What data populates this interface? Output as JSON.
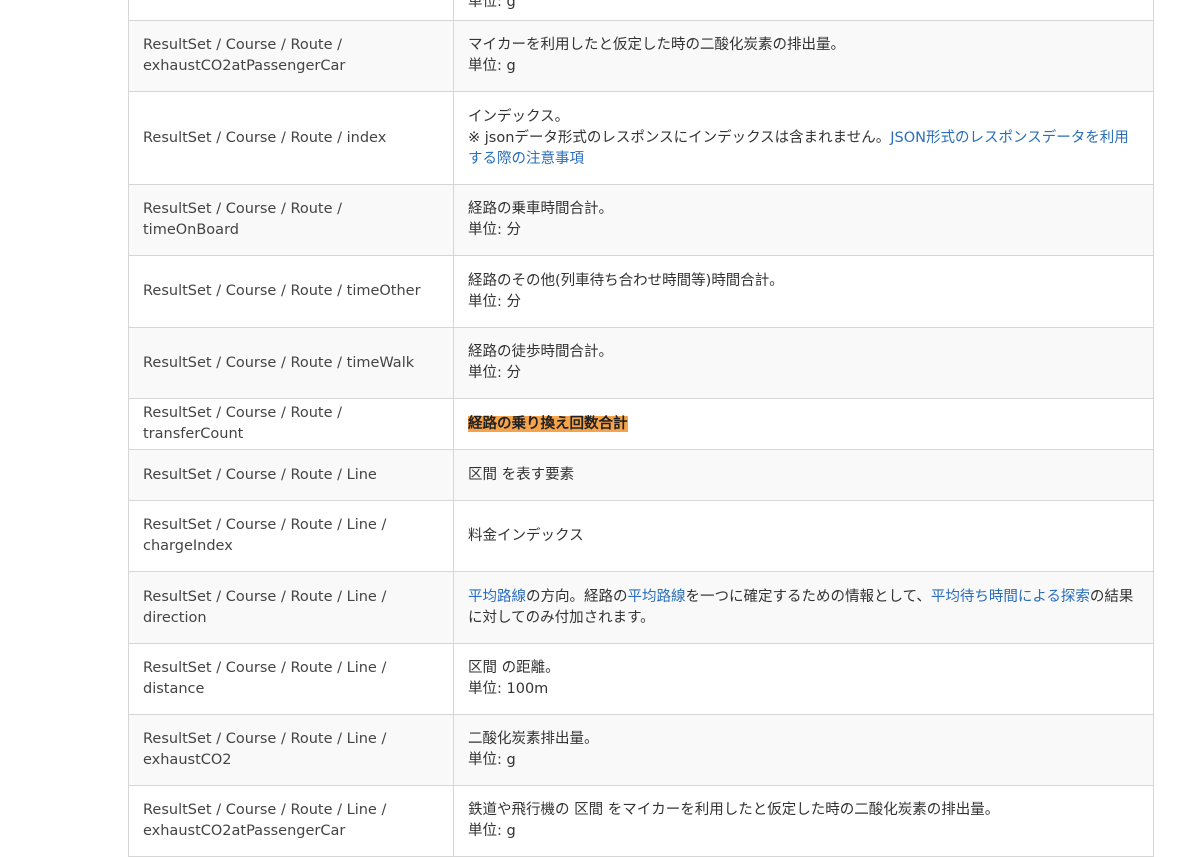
{
  "table": {
    "row_top": {
      "key": "",
      "desc": "単位: g"
    },
    "rows": [
      {
        "key": "ResultSet / Course / Route / exhaustCO2atPassengerCar",
        "desc1": "マイカーを利用したと仮定した時の二酸化炭素の排出量。",
        "desc2": "単位: g"
      },
      {
        "key": "ResultSet / Course / Route / index",
        "desc1": "インデックス。",
        "desc2_pre": "※ jsonデータ形式のレスポンスにインデックスは含まれません。",
        "desc2_link": "JSON形式のレスポンスデータを利用する際の注意事項"
      },
      {
        "key": "ResultSet / Course / Route / timeOnBoard",
        "desc1": "経路の乗車時間合計。",
        "desc2": "単位: 分"
      },
      {
        "key": "ResultSet / Course / Route / timeOther",
        "desc1": "経路のその他(列車待ち合わせ時間等)時間合計。",
        "desc2": "単位: 分"
      },
      {
        "key": "ResultSet / Course / Route / timeWalk",
        "desc1": "経路の徒歩時間合計。",
        "desc2": "単位: 分"
      },
      {
        "key": "ResultSet / Course / Route / transferCount",
        "desc_highlight": "経路の乗り換え回数合計"
      },
      {
        "key": "ResultSet / Course / Route / Line",
        "desc1": "区間 を表す要素"
      },
      {
        "key": "ResultSet / Course / Route / Line / chargeIndex",
        "desc1": "料金インデックス"
      },
      {
        "key": "ResultSet / Course / Route / Line / direction",
        "link1": "平均路線",
        "text1": "の方向。経路の",
        "link2": "平均路線",
        "text2": "を一つに確定するための情報として、",
        "link3": "平均待ち時間による探索",
        "text3": "の結果に対してのみ付加されます。"
      },
      {
        "key": "ResultSet / Course / Route / Line / distance",
        "desc1": "区間 の距離。",
        "desc2": "単位: 100m"
      },
      {
        "key": "ResultSet / Course / Route / Line / exhaustCO2",
        "desc1": "二酸化炭素排出量。",
        "desc2": "単位: g"
      },
      {
        "key": "ResultSet / Course / Route / Line / exhaustCO2atPassengerCar",
        "desc1": "鉄道や飛行機の 区間 をマイカーを利用したと仮定した時の二酸化炭素の排出量。",
        "desc2": "単位: g"
      }
    ]
  }
}
